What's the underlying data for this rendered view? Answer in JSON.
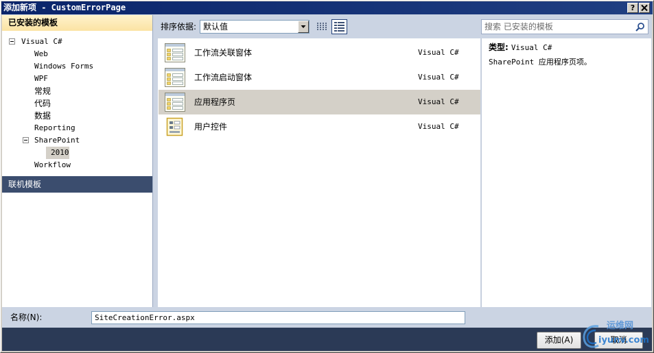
{
  "window": {
    "title": "添加新项 - CustomErrorPage",
    "help_label": "?"
  },
  "sidebar": {
    "installed_header": "已安装的模板",
    "tree": [
      "Visual C#",
      "Web",
      "Windows Forms",
      "WPF",
      "常规",
      "代码",
      "数据",
      "Reporting",
      "SharePoint",
      "2010",
      "Workflow"
    ],
    "online_header": "联机模板"
  },
  "toolbar": {
    "sort_label": "排序依据:",
    "sort_value": "默认值",
    "search_placeholder": "搜索 已安装的模板"
  },
  "templates": [
    {
      "name": "工作流关联窗体",
      "language": "Visual C#",
      "icon": "form-template-icon"
    },
    {
      "name": "工作流启动窗体",
      "language": "Visual C#",
      "icon": "form-template-icon"
    },
    {
      "name": "应用程序页",
      "language": "Visual C#",
      "icon": "form-template-icon"
    },
    {
      "name": "用户控件",
      "language": "Visual C#",
      "icon": "user-control-icon"
    }
  ],
  "details": {
    "type_label": "类型:",
    "type_value": "Visual C#",
    "description": "SharePoint 应用程序页项。"
  },
  "name_field": {
    "label": "名称(N):",
    "value": "SiteCreationError.aspx"
  },
  "buttons": {
    "add_label": "添加(A)",
    "cancel_label": "取消"
  },
  "watermark": {
    "brand_cn": "运维网",
    "brand_url": "iyunv.com"
  },
  "colors": {
    "title_bar": "#0a246a",
    "panel_bg": "#cbd4e3",
    "selection": "#d4d0c8",
    "installed_header": "#fbe3a3",
    "online_header": "#3b4d6e",
    "footer": "#2b3a56"
  }
}
